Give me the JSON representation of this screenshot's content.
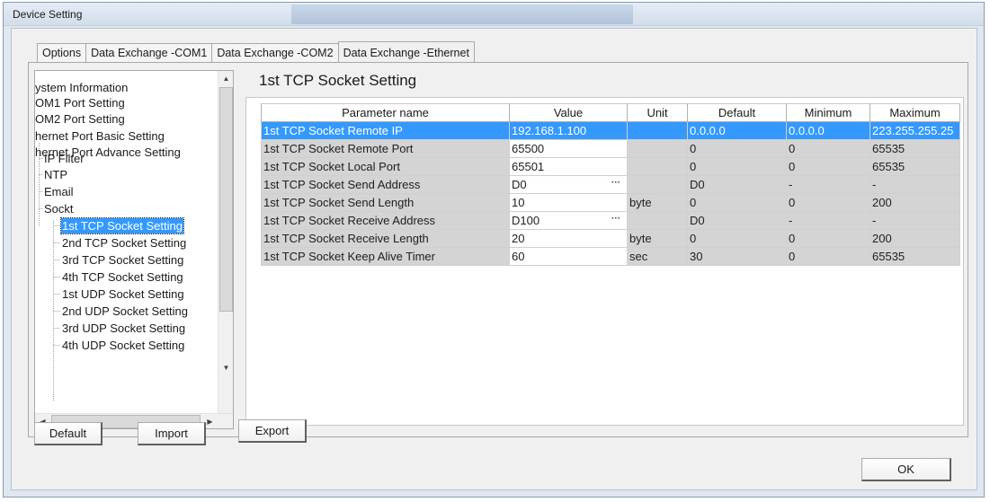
{
  "window": {
    "title": "Device Setting"
  },
  "tabs": [
    {
      "label": "Options"
    },
    {
      "label": "Data Exchange -COM1"
    },
    {
      "label": "Data Exchange -COM2"
    },
    {
      "label": "Data Exchange -Ethernet"
    }
  ],
  "tree": {
    "items": [
      {
        "label": "ystem Information"
      },
      {
        "label": "OM1 Port Setting"
      },
      {
        "label": "OM2 Port Setting"
      },
      {
        "label": "hernet Port Basic Setting"
      },
      {
        "label": "hernet Port Advance Setting"
      },
      {
        "label": "IP Filter"
      },
      {
        "label": "NTP"
      },
      {
        "label": "Email"
      },
      {
        "label": "Sockt"
      },
      {
        "label": "1st TCP Socket Setting"
      },
      {
        "label": "2nd TCP Socket Setting"
      },
      {
        "label": "3rd TCP Socket Setting"
      },
      {
        "label": "4th TCP Socket Setting"
      },
      {
        "label": "1st UDP Socket Setting"
      },
      {
        "label": "2nd UDP Socket Setting"
      },
      {
        "label": "3rd UDP Socket Setting"
      },
      {
        "label": "4th UDP Socket Setting"
      }
    ],
    "selected": "1st TCP Socket Setting"
  },
  "section": {
    "title": "1st TCP Socket Setting"
  },
  "grid": {
    "headers": [
      "Parameter name",
      "Value",
      "Unit",
      "Default",
      "Minimum",
      "Maximum"
    ],
    "rows": [
      {
        "name": "1st TCP Socket Remote IP",
        "value": "192.168.1.100",
        "unit": "",
        "default": "0.0.0.0",
        "min": "0.0.0.0",
        "max": "223.255.255.25"
      },
      {
        "name": "1st TCP Socket Remote Port",
        "value": "65500",
        "unit": "",
        "default": "0",
        "min": "0",
        "max": "65535"
      },
      {
        "name": "1st TCP Socket Local Port",
        "value": "65501",
        "unit": "",
        "default": "0",
        "min": "0",
        "max": "65535"
      },
      {
        "name": "1st TCP Socket Send Address",
        "value": "D0",
        "unit": "",
        "default": "D0",
        "min": "-",
        "max": "-"
      },
      {
        "name": "1st TCP Socket Send Length",
        "value": "10",
        "unit": "byte",
        "default": "0",
        "min": "0",
        "max": "200"
      },
      {
        "name": "1st TCP Socket Receive Address",
        "value": "D100",
        "unit": "",
        "default": "D0",
        "min": "-",
        "max": "-"
      },
      {
        "name": "1st TCP Socket Receive Length",
        "value": "20",
        "unit": "byte",
        "default": "0",
        "min": "0",
        "max": "200"
      },
      {
        "name": "1st TCP Socket Keep Alive Timer",
        "value": "60",
        "unit": "sec",
        "default": "30",
        "min": "0",
        "max": "65535"
      }
    ],
    "ellipsis": "···"
  },
  "buttons": {
    "default": "Default",
    "import": "Import",
    "export": "Export",
    "ok": "OK"
  },
  "scroll_glyphs": {
    "up": "▲",
    "down": "▼",
    "left": "◀",
    "right": "▶"
  }
}
